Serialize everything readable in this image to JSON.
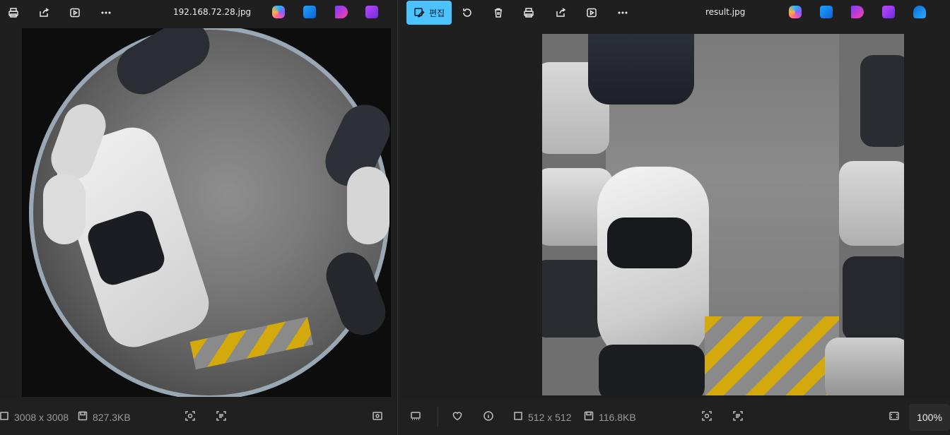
{
  "left_window": {
    "title": "192.168.72.28.jpg",
    "status": {
      "dimensions": "3008 x 3008",
      "file_size": "827.3KB"
    }
  },
  "right_window": {
    "title": "result.jpg",
    "edit_label": "편집",
    "status": {
      "dimensions": "512 x 512",
      "file_size": "116.8KB",
      "zoom": "100%"
    }
  },
  "colors": {
    "accent": "#4cc2ff",
    "background": "#1f1f1f",
    "parking_stripe": "#d4a90b"
  },
  "icons": [
    "print-icon",
    "share-icon",
    "slideshow-icon",
    "more-icon",
    "copilot-icon",
    "designer-icon",
    "clipchamp-icon",
    "photos-icon",
    "onedrive-icon",
    "rotate-icon",
    "delete-icon",
    "filmstrip-icon",
    "favorite-icon",
    "info-icon",
    "visual-search-icon",
    "text-extract-icon",
    "fit-window-icon"
  ]
}
